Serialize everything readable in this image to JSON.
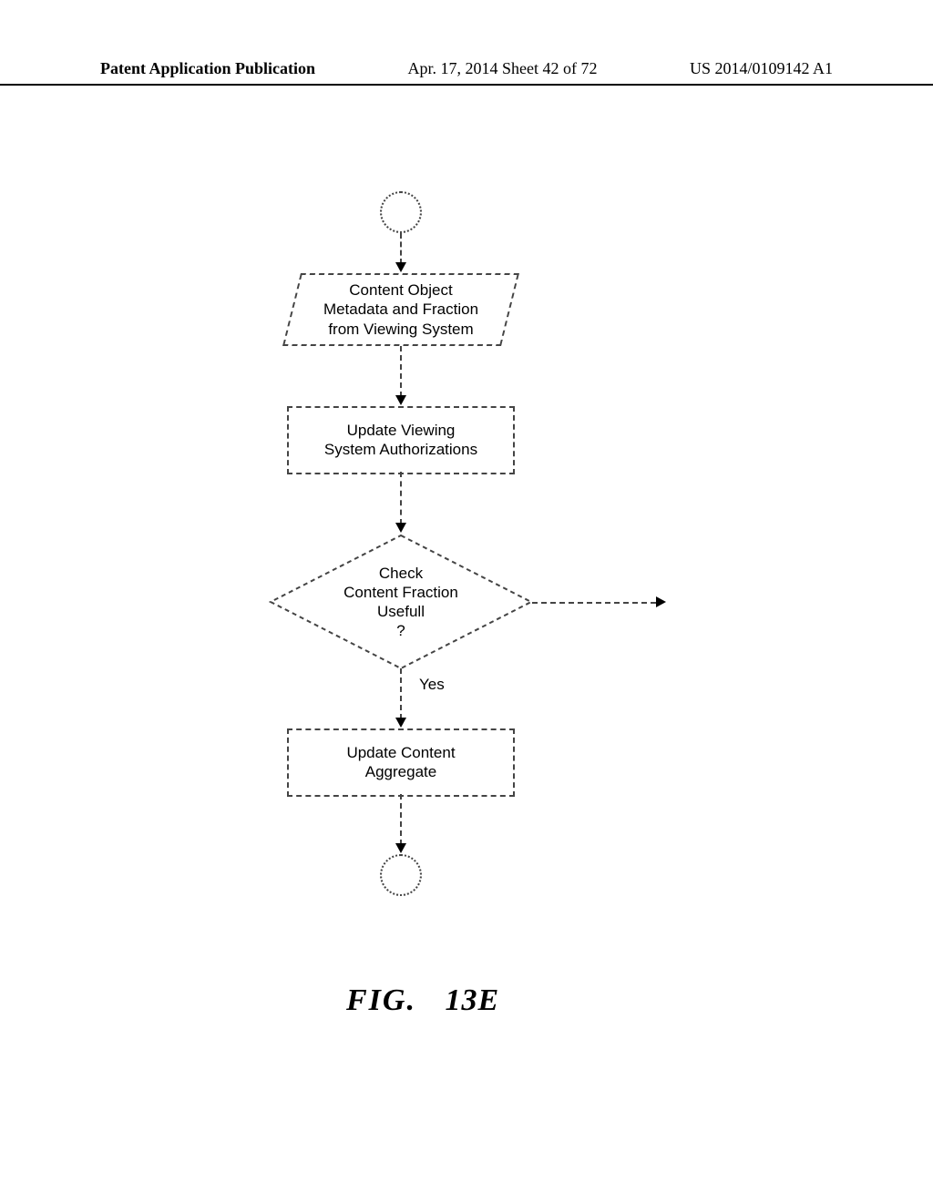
{
  "header": {
    "left": "Patent Application Publication",
    "center": "Apr. 17, 2014  Sheet 42 of 72",
    "right": "US 2014/0109142 A1"
  },
  "flow": {
    "input_line1": "Content Object",
    "input_line2": "Metadata and Fraction",
    "input_line3": "from Viewing System",
    "process1_line1": "Update Viewing",
    "process1_line2": "System Authorizations",
    "decision_line1": "Check",
    "decision_line2": "Content Fraction",
    "decision_line3": "Usefull",
    "decision_line4": "?",
    "decision_yes": "Yes",
    "process2_line1": "Update Content",
    "process2_line2": "Aggregate"
  },
  "figure": {
    "label_prefix": "FIG.",
    "label_num": "13E"
  }
}
